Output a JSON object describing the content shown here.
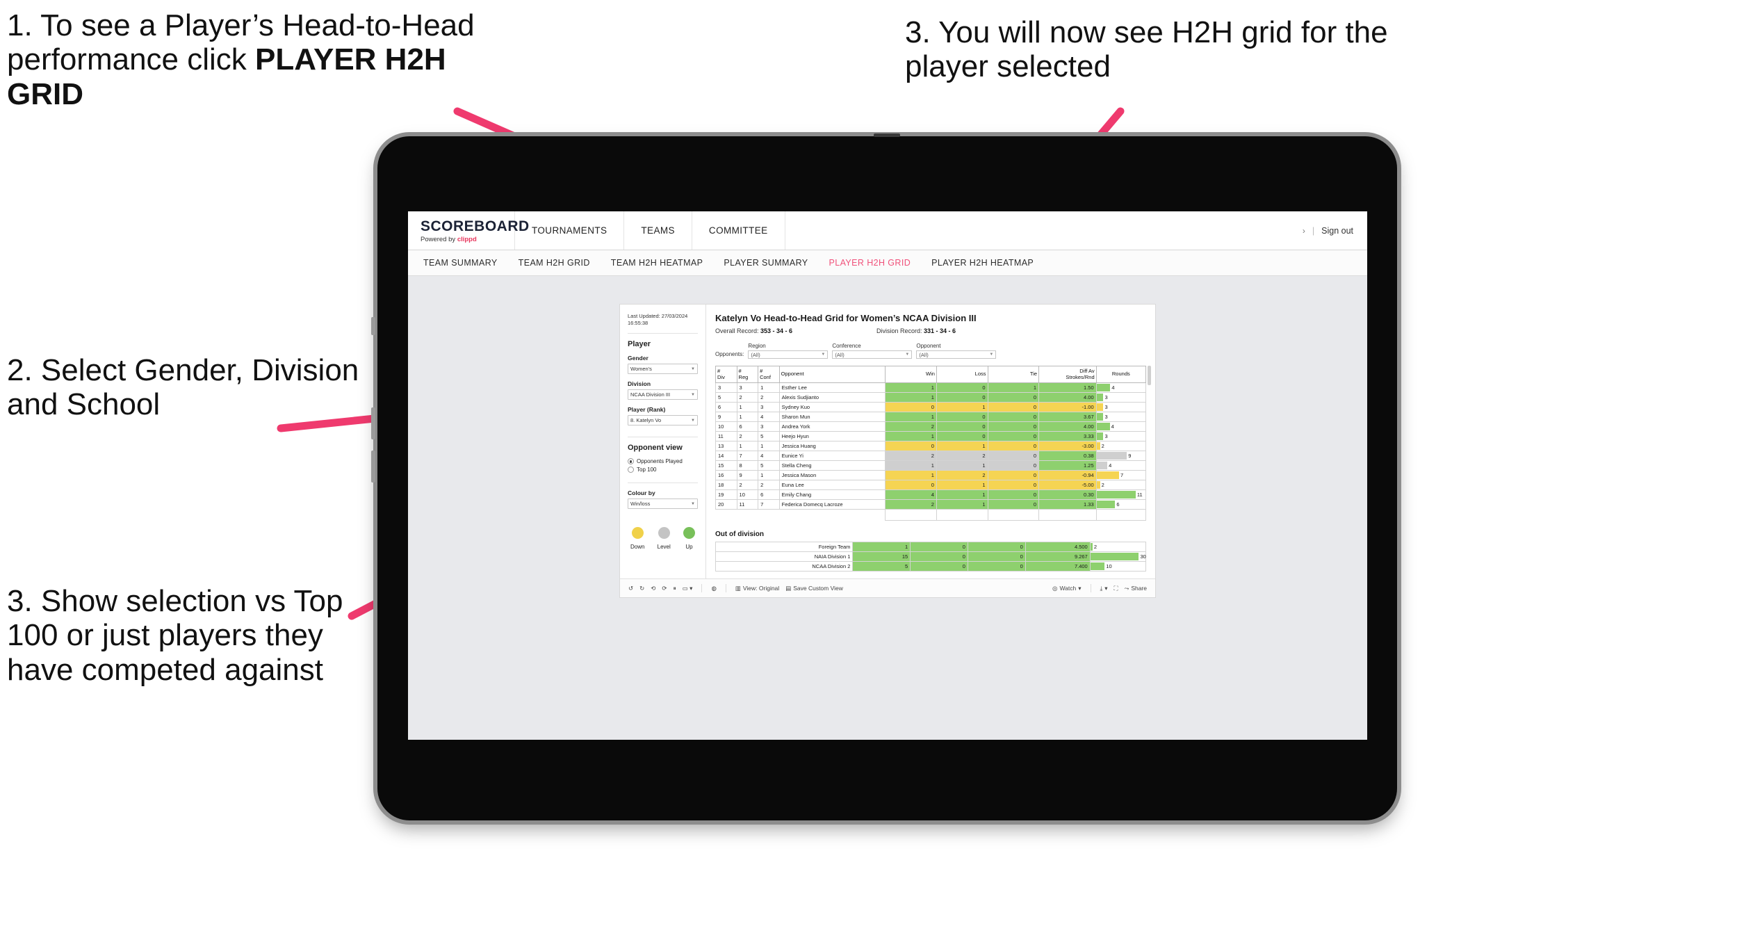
{
  "annotations": [
    {
      "id": "anno-1",
      "text_before": "1. To see a Player’s Head-to-Head performance click ",
      "bold": "PLAYER H2H GRID"
    },
    {
      "id": "anno-2",
      "text": "2. Select Gender, Division and School"
    },
    {
      "id": "anno-3",
      "text": "3. Show selection vs Top 100 or just players they have competed against"
    },
    {
      "id": "anno-4",
      "text": "3. You will now see H2H grid for the player selected"
    }
  ],
  "accent_color": "#ef3a6e",
  "brand": {
    "logo": "SCOREBOARD",
    "powered_prefix": "Powered by ",
    "powered_name": "clippd"
  },
  "header": {
    "nav": [
      "TOURNAMENTS",
      "TEAMS",
      "COMMITTEE"
    ],
    "chevron": "›",
    "separator": "|",
    "sign_out": "Sign out"
  },
  "subnav": {
    "tabs": [
      {
        "label": "TEAM SUMMARY",
        "active": false
      },
      {
        "label": "TEAM H2H GRID",
        "active": false
      },
      {
        "label": "TEAM H2H HEATMAP",
        "active": false
      },
      {
        "label": "PLAYER SUMMARY",
        "active": false
      },
      {
        "label": "PLAYER H2H GRID",
        "active": true
      },
      {
        "label": "PLAYER H2H HEATMAP",
        "active": false
      }
    ]
  },
  "sidebar": {
    "last_updated": "Last Updated: 27/03/2024 16:55:38",
    "player_section_title": "Player",
    "filters": [
      {
        "label": "Gender",
        "value": "Women's"
      },
      {
        "label": "Division",
        "value": "NCAA Division III"
      },
      {
        "label": "Player (Rank)",
        "value": "8. Katelyn Vo"
      }
    ],
    "opponent_view": {
      "title": "Opponent view",
      "options": [
        {
          "label": "Opponents Played",
          "selected": true
        },
        {
          "label": "Top 100",
          "selected": false
        }
      ]
    },
    "colour_by": {
      "label": "Colour by",
      "value": "Win/loss"
    },
    "legend": [
      {
        "label": "Down",
        "color": "#f0d14a"
      },
      {
        "label": "Level",
        "color": "#c4c4c4"
      },
      {
        "label": "Up",
        "color": "#78c05a"
      }
    ]
  },
  "main": {
    "title": "Katelyn Vo Head-to-Head Grid for Women’s NCAA Division III",
    "overall_record_label": "Overall Record: ",
    "overall_record_value": "353 -  34 - 6",
    "division_record_label": "Division Record: ",
    "division_record_value": "331 -  34 - 6",
    "opponents_label": "Opponents:",
    "opponent_filters": [
      {
        "caption": "Region",
        "value": "(All)"
      },
      {
        "caption": "Conference",
        "value": "(All)"
      },
      {
        "caption": "Opponent",
        "value": "(All)"
      }
    ],
    "columns": [
      "# Div",
      "# Reg",
      "# Conf",
      "Opponent",
      "Win",
      "Loss",
      "Tie",
      "Diff Av Strokes/Rnd",
      "Rounds"
    ],
    "rows": [
      {
        "div": "3",
        "reg": "3",
        "conf": "1",
        "opponent": "Esther Lee",
        "win": "1",
        "loss": "0",
        "tie": "1",
        "diff": "1.50",
        "rounds": "4",
        "color": "g",
        "bar_pct": 28
      },
      {
        "div": "5",
        "reg": "2",
        "conf": "2",
        "opponent": "Alexis Sudjianto",
        "win": "1",
        "loss": "0",
        "tie": "0",
        "diff": "4.00",
        "rounds": "3",
        "color": "g",
        "bar_pct": 14
      },
      {
        "div": "6",
        "reg": "1",
        "conf": "3",
        "opponent": "Sydney Kuo",
        "win": "0",
        "loss": "1",
        "tie": "0",
        "diff": "-1.00",
        "rounds": "3",
        "color": "y",
        "bar_pct": 14
      },
      {
        "div": "9",
        "reg": "1",
        "conf": "4",
        "opponent": "Sharon Mun",
        "win": "1",
        "loss": "0",
        "tie": "0",
        "diff": "3.67",
        "rounds": "3",
        "color": "g",
        "bar_pct": 14
      },
      {
        "div": "10",
        "reg": "6",
        "conf": "3",
        "opponent": "Andrea York",
        "win": "2",
        "loss": "0",
        "tie": "0",
        "diff": "4.00",
        "rounds": "4",
        "color": "g",
        "bar_pct": 27
      },
      {
        "div": "11",
        "reg": "2",
        "conf": "5",
        "opponent": "Heejo Hyun",
        "win": "1",
        "loss": "0",
        "tie": "0",
        "diff": "3.33",
        "rounds": "3",
        "color": "g",
        "bar_pct": 14
      },
      {
        "div": "13",
        "reg": "1",
        "conf": "1",
        "opponent": "Jessica Huang",
        "win": "0",
        "loss": "1",
        "tie": "0",
        "diff": "-3.00",
        "rounds": "2",
        "color": "y",
        "bar_pct": 7
      },
      {
        "div": "14",
        "reg": "7",
        "conf": "4",
        "opponent": "Eunice Yi",
        "win": "2",
        "loss": "2",
        "tie": "0",
        "diff": "0.38",
        "rounds": "9",
        "color": "n",
        "diff_color": "g",
        "bar_pct": 62
      },
      {
        "div": "15",
        "reg": "8",
        "conf": "5",
        "opponent": "Stella Cheng",
        "win": "1",
        "loss": "1",
        "tie": "0",
        "diff": "1.25",
        "rounds": "4",
        "color": "n",
        "diff_color": "g",
        "bar_pct": 22
      },
      {
        "div": "16",
        "reg": "9",
        "conf": "1",
        "opponent": "Jessica Mason",
        "win": "1",
        "loss": "2",
        "tie": "0",
        "diff": "-0.94",
        "rounds": "7",
        "color": "y",
        "bar_pct": 46
      },
      {
        "div": "18",
        "reg": "2",
        "conf": "2",
        "opponent": "Euna Lee",
        "win": "0",
        "loss": "1",
        "tie": "0",
        "diff": "-5.00",
        "rounds": "2",
        "color": "y",
        "bar_pct": 7
      },
      {
        "div": "19",
        "reg": "10",
        "conf": "6",
        "opponent": "Emily Chang",
        "win": "4",
        "loss": "1",
        "tie": "0",
        "diff": "0.30",
        "rounds": "11",
        "color": "g",
        "bar_pct": 80
      },
      {
        "div": "20",
        "reg": "11",
        "conf": "7",
        "opponent": "Federica Domecq Lacroze",
        "win": "2",
        "loss": "1",
        "tie": "0",
        "diff": "1.33",
        "rounds": "6",
        "color": "g",
        "bar_pct": 38
      }
    ],
    "out_of_division": {
      "title": "Out of division",
      "rows": [
        {
          "name": "Foreign Team",
          "win": "1",
          "loss": "0",
          "tie": "0",
          "diff": "4.500",
          "rounds": "2",
          "color": "g",
          "bar_pct": 4
        },
        {
          "name": "NAIA Division 1",
          "win": "15",
          "loss": "0",
          "tie": "0",
          "diff": "9.267",
          "rounds": "30",
          "color": "g",
          "bar_pct": 88
        },
        {
          "name": "NCAA Division 2",
          "win": "5",
          "loss": "0",
          "tie": "0",
          "diff": "7.400",
          "rounds": "10",
          "color": "g",
          "bar_pct": 26
        }
      ]
    }
  },
  "toolbar": {
    "view_label": "View: Original",
    "save_label": "Save Custom View",
    "watch_label": "Watch",
    "share_label": "Share"
  }
}
